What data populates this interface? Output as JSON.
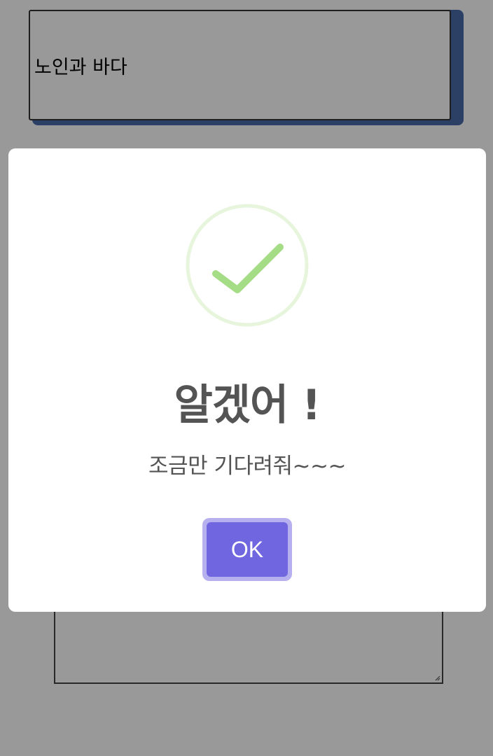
{
  "page": {
    "title_card_text": "노인과 바다"
  },
  "modal": {
    "icon": "success-check-icon",
    "title": "알겠어 !",
    "text": "조금만 기다려줘~~~",
    "ok_label": "OK"
  },
  "colors": {
    "accent_button": "#7066e0",
    "button_focus_ring": "#b6b0ee",
    "success_check": "#a5dc86",
    "success_ring": "#e6f5dc",
    "card_shadow": "#4a6aa8",
    "text": "#545454"
  }
}
